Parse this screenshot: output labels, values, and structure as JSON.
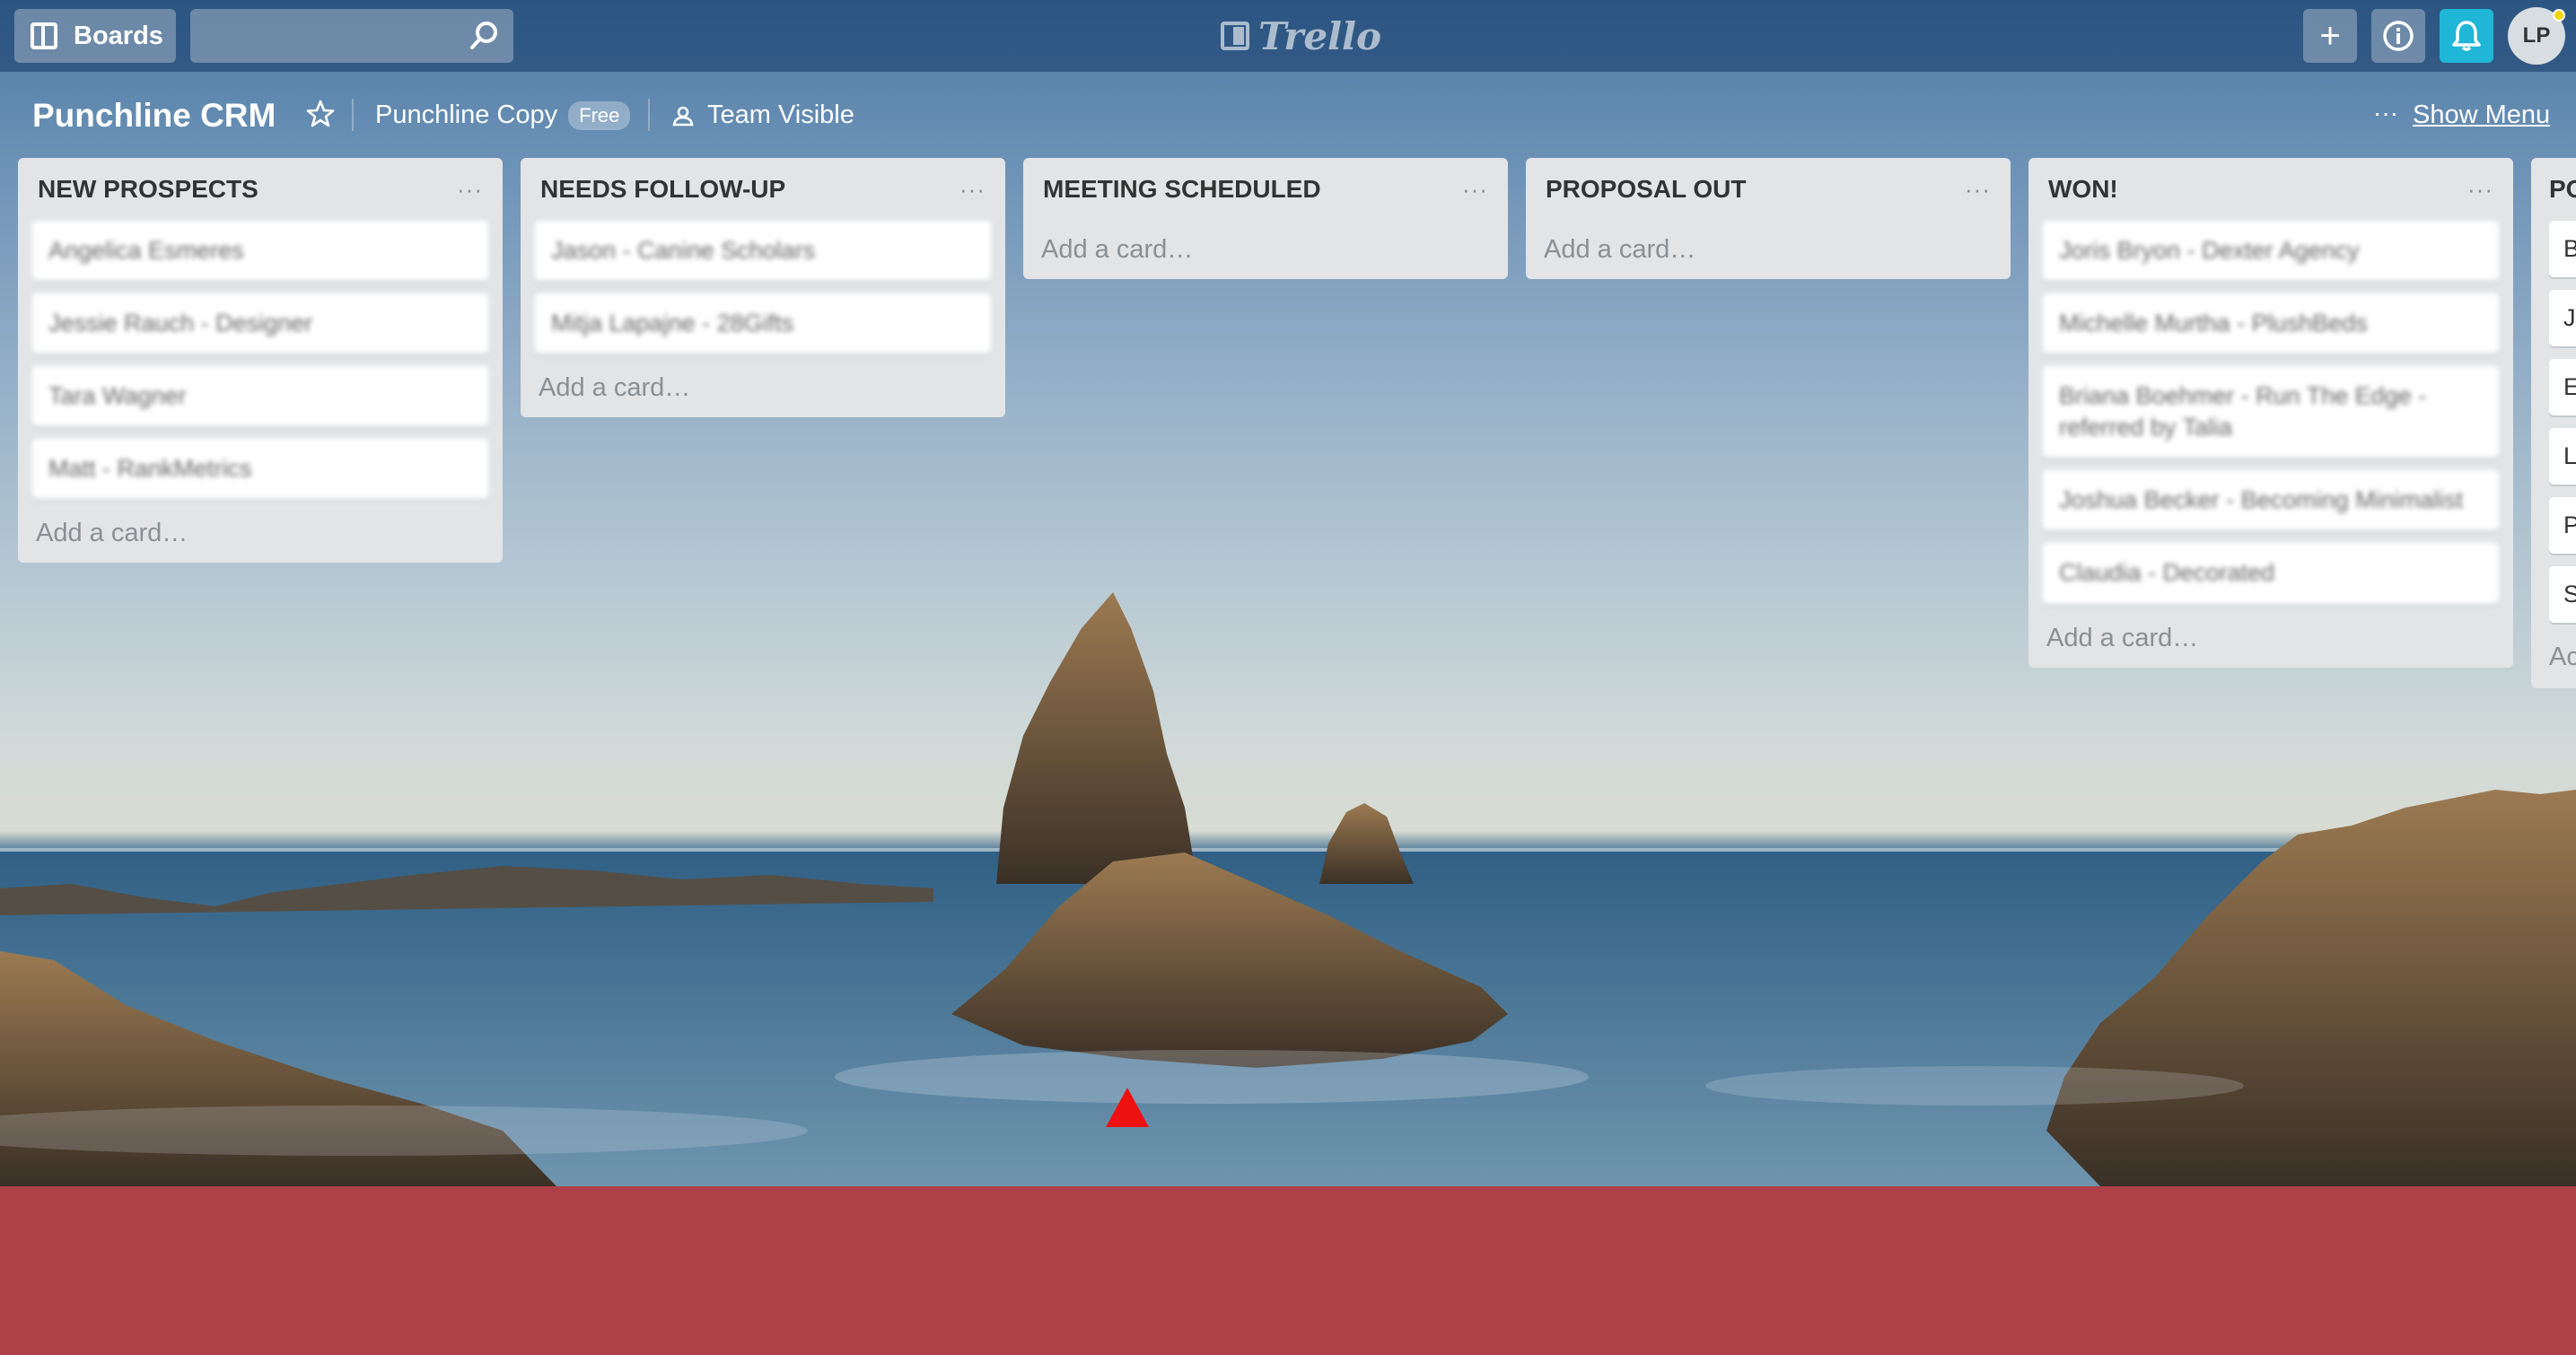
{
  "header": {
    "boards_label": "Boards",
    "search_value": "",
    "logo_text": "Trello",
    "avatar_initials": "LP",
    "plus_label": "+",
    "info_label": "i"
  },
  "board": {
    "title": "Punchline CRM",
    "team_name": "Punchline Copy",
    "team_badge": "Free",
    "visibility": "Team Visible",
    "menu_dots": "···",
    "show_menu": "Show Menu"
  },
  "lists": [
    {
      "title": "NEW PROSPECTS",
      "dots": "···",
      "cards": [
        "Angelica Esmeres",
        "Jessie Rauch - Designer",
        "Tara Wagner",
        "Matt - RankMetrics"
      ],
      "add_card": "Add a card…"
    },
    {
      "title": "NEEDS FOLLOW-UP",
      "dots": "···",
      "cards": [
        "Jason - Canine Scholars",
        "Mitja Lapajne - 28Gifts"
      ],
      "add_card": "Add a card…"
    },
    {
      "title": "MEETING SCHEDULED",
      "dots": "···",
      "cards": [],
      "add_card": "Add a card…"
    },
    {
      "title": "PROPOSAL OUT",
      "dots": "···",
      "cards": [],
      "add_card": "Add a card…"
    },
    {
      "title": "WON!",
      "dots": "···",
      "cards": [
        "Joris Bryon - Dexter Agency",
        "Michelle Murtha - PlushBeds",
        "Briana Boehmer - Run The Edge - referred by Talia",
        "Joshua Becker - Becoming Minimalist",
        "Claudia - Decorated"
      ],
      "add_card": "Add a card…"
    }
  ],
  "partial_list": {
    "title": "PO",
    "cards": [
      "B",
      "Jo",
      "E",
      "L",
      "P",
      "S"
    ],
    "add_card": "Ac"
  },
  "colors": {
    "header_bg": "#2a5a85",
    "notification_bell": "#1fb6d8",
    "list_bg": "#e2e4e6",
    "bottom_band": "#b04048",
    "marker": "#ee1111"
  }
}
